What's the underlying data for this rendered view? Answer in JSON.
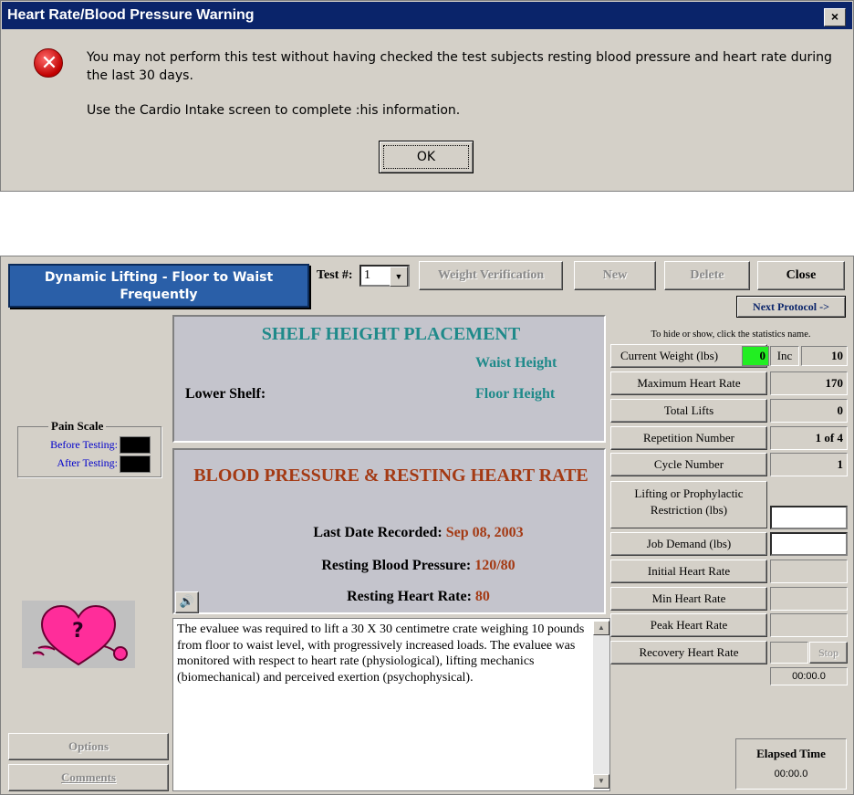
{
  "dialog": {
    "title": "Heart Rate/Blood Pressure Warning",
    "close_label": "×",
    "icon": "error-icon",
    "message_line1": "You may not perform this test without having checked the test subjects resting blood pressure and heart rate during the last 30 days.",
    "message_line2": "Use the Cardio Intake screen to complete :his information.",
    "ok_label": "OK"
  },
  "main": {
    "protocol_title": "Dynamic Lifting - Floor to Waist Frequently",
    "test_label": "Test #:",
    "test_value": "1",
    "toolbar": {
      "weight_verification": "Weight Verification",
      "new": "New",
      "delete": "Delete",
      "close": "Close",
      "next_protocol": "Next Protocol ->"
    },
    "pain_scale": {
      "title": "Pain Scale",
      "before_label": "Before Testing:",
      "after_label": "After Testing:"
    },
    "shelf": {
      "title": "SHELF HEIGHT PLACEMENT",
      "upper_value": "Waist Height",
      "lower_label": "Lower Shelf:",
      "lower_value": "Floor Height"
    },
    "blood_pressure": {
      "title": "BLOOD PRESSURE & RESTING HEART RATE",
      "date_label": "Last Date Recorded:",
      "date_value": "Sep 08, 2003",
      "bp_label": "Resting Blood Pressure:",
      "bp_value": "120/80",
      "hr_label": "Resting Heart Rate:",
      "hr_value": "80"
    },
    "description": "The evaluee was required to lift a 30 X 30 centimetre crate weighing 10 pounds from floor to waist level, with progressively increased loads. The evaluee was monitored with respect to heart rate (physiological), lifting mechanics (biomechanical) and perceived exertion (psychophysical).",
    "stats_hint": "To hide or show, click the statistics name.",
    "stats": {
      "current_weight_label": "Current Weight (lbs)",
      "current_weight_value": "0",
      "inc_label": "Inc",
      "inc_value": "10",
      "max_hr_label": "Maximum Heart Rate",
      "max_hr_value": "170",
      "total_lifts_label": "Total Lifts",
      "total_lifts_value": "0",
      "repetition_label": "Repetition Number",
      "repetition_value": "1 of 4",
      "cycle_label": "Cycle Number",
      "cycle_value": "1",
      "restriction_label": "Lifting or Prophylactic Restriction (lbs)",
      "job_demand_label": "Job Demand (lbs)",
      "initial_hr_label": "Initial Heart Rate",
      "min_hr_label": "Min Heart Rate",
      "peak_hr_label": "Peak Heart Rate",
      "recovery_hr_label": "Recovery Heart Rate",
      "stop_label": "Stop",
      "recovery_timer": "00:00.0"
    },
    "elapsed": {
      "title": "Elapsed Time",
      "value": "00:00.0"
    },
    "bottom_buttons": {
      "options": "Options",
      "comments": "Comments"
    },
    "colors": {
      "title_blue": "#2a5fa8",
      "teal": "#1f8a8a",
      "rust": "#a43a14",
      "weight_green": "#22ee22"
    }
  }
}
